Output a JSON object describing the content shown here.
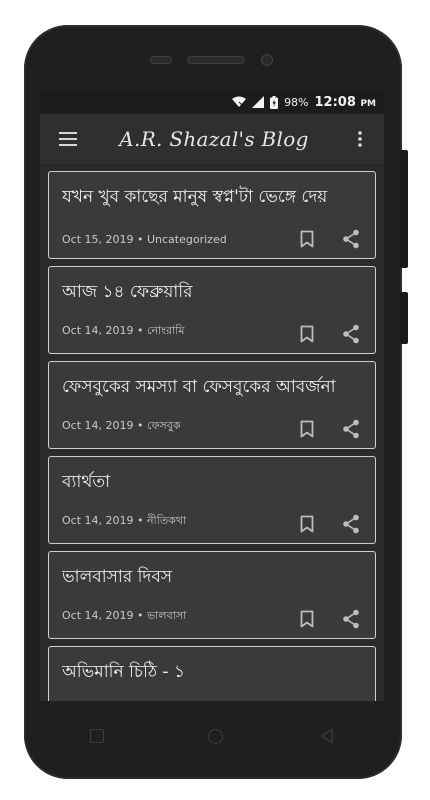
{
  "status_bar": {
    "battery": "98%",
    "time": "12:08",
    "ampm": "PM"
  },
  "app_bar": {
    "title": "A.R. Shazal's Blog"
  },
  "posts": [
    {
      "title": "যখন খুব কাছের মানুষ স্বপ্ন'টা ভেঙ্গে দেয়",
      "date": "Oct 15, 2019",
      "category": "Uncategorized"
    },
    {
      "title": "আজ ১৪ ফেব্রুয়ারি",
      "date": "Oct 14, 2019",
      "category": "নোংরামি"
    },
    {
      "title": "ফেসবুকের সমস্যা বা ফেসবুকের আবর্জনা",
      "date": "Oct 14, 2019",
      "category": "ফেসবুক"
    },
    {
      "title": "ব্যার্থতা",
      "date": "Oct 14, 2019",
      "category": "নীতিকথা"
    },
    {
      "title": "ভালবাসার দিবস",
      "date": "Oct 14, 2019",
      "category": "ভালবাসা"
    },
    {
      "title": "অভিমানি চিঠি - ১",
      "date": "",
      "category": ""
    }
  ],
  "colors": {
    "screen_bg": "#2b2b2b",
    "card_bg": "#3a3a3a",
    "card_border": "#cfcfcf",
    "icon": "#bdbdbd"
  }
}
